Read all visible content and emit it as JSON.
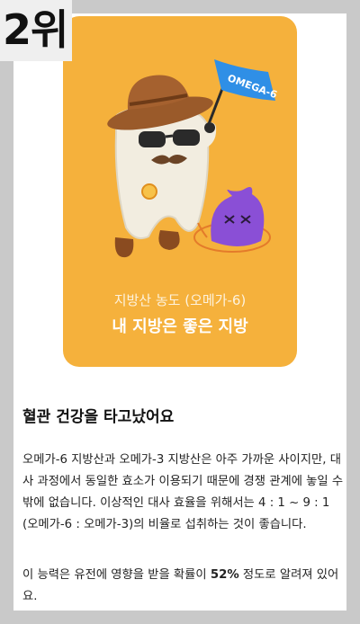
{
  "rank": {
    "label": "2위"
  },
  "card": {
    "flag_text": "OMEGA-6",
    "subtitle": "지방산 농도 (오메가-6)",
    "title": "내 지방은 좋은 지방"
  },
  "content": {
    "heading": "혈관 건강을 타고났어요",
    "paragraph1": "오메가-6 지방산과 오메가-3 지방산은 아주 가까운 사이지만, 대사 과정에서 동일한 효소가 이용되기 때문에 경쟁 관계에 놓일 수밖에 없습니다. 이상적인 대사 효율을 위해서는 4 : 1 ~ 9 : 1 (오메가-6 : 오메가-3)의 비율로 섭취하는 것이 좋습니다.",
    "paragraph2_before": "이 능력은 유전에 영향을 받을 확률이 ",
    "paragraph2_value": "52%",
    "paragraph2_after": " 정도로 알려져 있어요."
  },
  "colors": {
    "card_background": "#f5b13c",
    "flag": "#2f8fe6",
    "monster": "#8a4fd6"
  }
}
